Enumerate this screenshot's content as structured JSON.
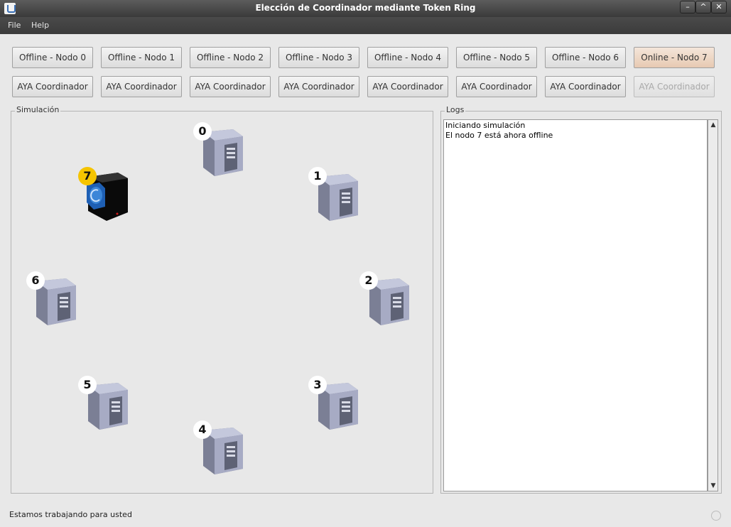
{
  "window": {
    "title": "Elección de Coordinador mediante Token Ring"
  },
  "menu": {
    "file": "File",
    "help": "Help"
  },
  "toggle_buttons": [
    {
      "label": "Offline - Nodo 0",
      "state": "normal"
    },
    {
      "label": "Offline - Nodo 1",
      "state": "normal"
    },
    {
      "label": "Offline - Nodo 2",
      "state": "normal"
    },
    {
      "label": "Offline - Nodo 3",
      "state": "normal"
    },
    {
      "label": "Offline - Nodo 4",
      "state": "normal"
    },
    {
      "label": "Offline - Nodo 5",
      "state": "normal"
    },
    {
      "label": "Offline - Nodo 6",
      "state": "normal"
    },
    {
      "label": "Online - Nodo 7",
      "state": "highlighted"
    }
  ],
  "aya_buttons": [
    {
      "label": "AYA Coordinador",
      "enabled": true
    },
    {
      "label": "AYA Coordinador",
      "enabled": true
    },
    {
      "label": "AYA Coordinador",
      "enabled": true
    },
    {
      "label": "AYA Coordinador",
      "enabled": true
    },
    {
      "label": "AYA Coordinador",
      "enabled": true
    },
    {
      "label": "AYA Coordinador",
      "enabled": true
    },
    {
      "label": "AYA Coordinador",
      "enabled": true
    },
    {
      "label": "AYA Coordinador",
      "enabled": false
    }
  ],
  "simulation": {
    "legend": "Simulación",
    "nodes": [
      {
        "id": "0",
        "icon": "server-icon",
        "offline": false
      },
      {
        "id": "1",
        "icon": "server-icon",
        "offline": false
      },
      {
        "id": "2",
        "icon": "server-icon",
        "offline": false
      },
      {
        "id": "3",
        "icon": "server-icon",
        "offline": false
      },
      {
        "id": "4",
        "icon": "server-icon",
        "offline": false
      },
      {
        "id": "5",
        "icon": "server-icon",
        "offline": false
      },
      {
        "id": "6",
        "icon": "server-icon",
        "offline": false
      },
      {
        "id": "7",
        "icon": "offline-server-icon",
        "offline": true,
        "coordinator": true
      }
    ],
    "coordinator_badge_color": "#f5c400"
  },
  "logs": {
    "legend": "Logs",
    "lines": [
      "Iniciando simulación",
      "El nodo 7 está ahora offline"
    ]
  },
  "status": {
    "text": "Estamos trabajando para usted"
  }
}
